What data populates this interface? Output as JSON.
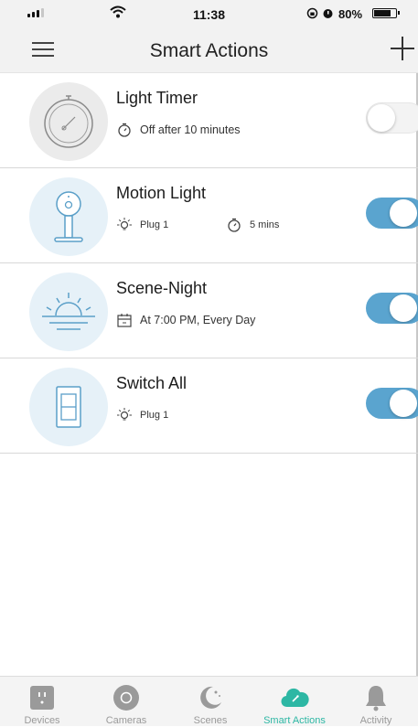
{
  "status_bar": {
    "time": "11:38",
    "battery_percent": "80%",
    "battery_level": 0.8
  },
  "header": {
    "title": "Smart Actions",
    "menu_icon": "hamburger-menu-icon",
    "add_icon": "plus-icon"
  },
  "actions": [
    {
      "title": "Light Timer",
      "icon": "dial-timer-icon",
      "meta": [
        {
          "icon": "stopwatch-icon",
          "text": "Off after 10 minutes"
        }
      ],
      "enabled": false
    },
    {
      "title": "Motion Light",
      "icon": "motion-sensor-icon",
      "meta": [
        {
          "icon": "bulb-icon",
          "text": "Plug 1"
        },
        {
          "icon": "stopwatch-icon",
          "text": "5 mins"
        }
      ],
      "enabled": true
    },
    {
      "title": "Scene-Night",
      "icon": "sunset-icon",
      "meta": [
        {
          "icon": "calendar-icon",
          "text": "At 7:00 PM, Every Day"
        }
      ],
      "enabled": true
    },
    {
      "title": "Switch All",
      "icon": "light-switch-icon",
      "meta": [
        {
          "icon": "bulb-icon",
          "text": "Plug 1"
        }
      ],
      "enabled": true
    }
  ],
  "tabs": [
    {
      "label": "Devices",
      "icon": "plug-icon"
    },
    {
      "label": "Cameras",
      "icon": "camera-icon"
    },
    {
      "label": "Scenes",
      "icon": "moon-icon"
    },
    {
      "label": "Smart Actions",
      "icon": "cloud-icon",
      "active": true
    },
    {
      "label": "Activity",
      "icon": "bell-icon"
    }
  ],
  "colors": {
    "toggle_on": "#5aa4cf",
    "tab_active": "#2db7a4",
    "tab_inactive": "#9a9a9a",
    "avatar_bg_blue": "#e6f1f8",
    "avatar_bg_gray": "#ebebeb"
  }
}
